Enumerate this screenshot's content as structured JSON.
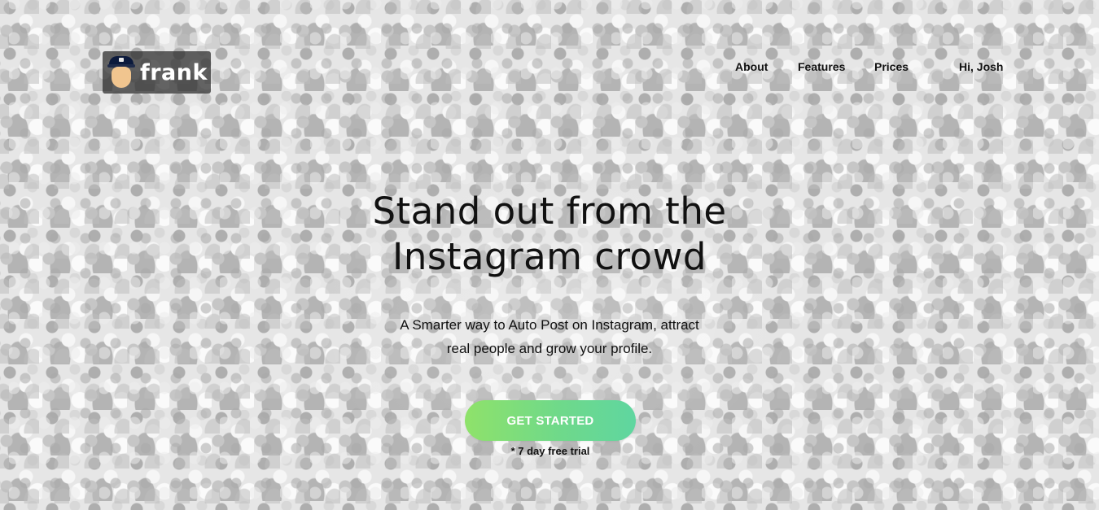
{
  "brand": {
    "name": "frank",
    "icon": "police-avatar-icon"
  },
  "nav": {
    "about": "About",
    "features": "Features",
    "prices": "Prices",
    "user": "Hi, Josh"
  },
  "hero": {
    "headline_line1": "Stand out from the",
    "headline_line2": "Instagram crowd",
    "subhead_line1": "A Smarter way to Auto Post on Instagram, attract",
    "subhead_line2": "real people and grow your profile.",
    "cta_label": "GET STARTED",
    "trial_note": "* 7 day free trial"
  },
  "colors": {
    "cta_gradient_start": "#8fe26a",
    "cta_gradient_end": "#5fd6a0",
    "text": "#111111",
    "logo_bg": "#282828"
  }
}
